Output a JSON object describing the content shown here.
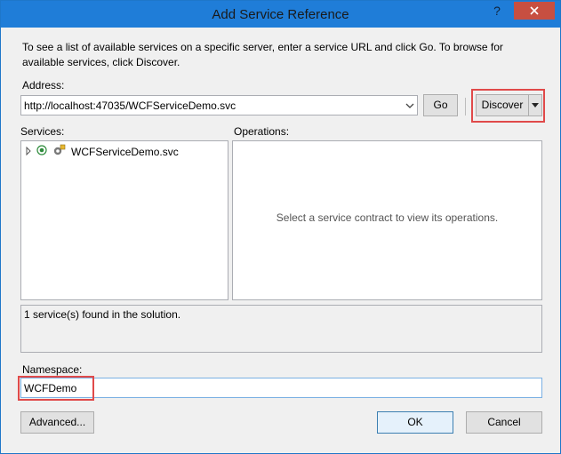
{
  "window": {
    "title": "Add Service Reference",
    "help_glyph": "?",
    "colors": {
      "titlebar": "#1f7dd8",
      "close": "#c74f41",
      "highlight": "#e04a4a"
    }
  },
  "intro_text": "To see a list of available services on a specific server, enter a service URL and click Go. To browse for available services, click Discover.",
  "address": {
    "label": "Address:",
    "value": "http://localhost:47035/WCFServiceDemo.svc",
    "go_label": "Go",
    "discover_label": "Discover"
  },
  "services": {
    "label": "Services:",
    "items": [
      {
        "label": "WCFServiceDemo.svc",
        "icon": "service-icon"
      }
    ]
  },
  "operations": {
    "label": "Operations:",
    "empty_message": "Select a service contract to view its operations."
  },
  "status_text": "1 service(s) found in the solution.",
  "namespace": {
    "label": "Namespace:",
    "value": "WCFDemo"
  },
  "footer": {
    "advanced_label": "Advanced...",
    "ok_label": "OK",
    "cancel_label": "Cancel"
  }
}
